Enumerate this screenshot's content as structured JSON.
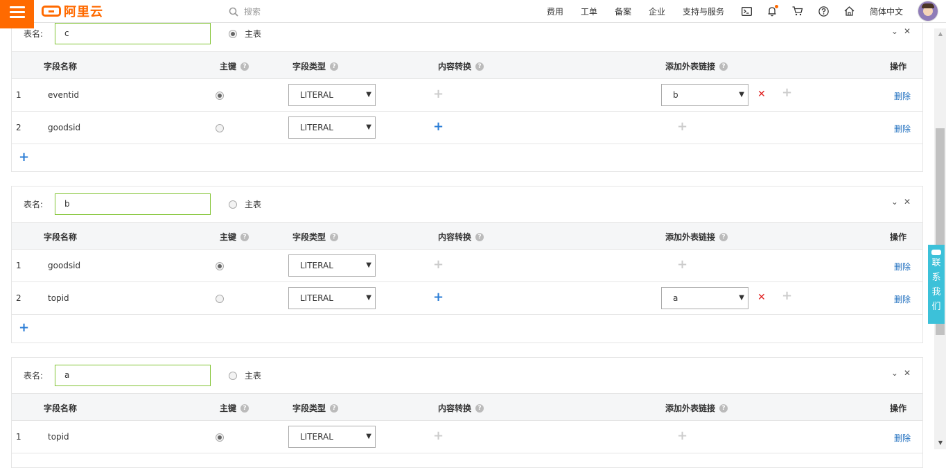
{
  "header": {
    "logo_text": "阿里云",
    "search_placeholder": "搜索",
    "nav": [
      "费用",
      "工单",
      "备案",
      "企业",
      "支持与服务"
    ],
    "language": "简体中文",
    "accent_color": "#ff6a00"
  },
  "labels": {
    "table_name": "表名:",
    "master_table": "主表",
    "delete": "删除"
  },
  "columns": {
    "field_name": "字段名称",
    "primary_key": "主键",
    "field_type": "字段类型",
    "content_convert": "内容转换",
    "foreign_link": "添加外表链接",
    "action": "操作"
  },
  "tables": [
    {
      "name": "c",
      "is_master": true,
      "rows": [
        {
          "index": "1",
          "field": "eventid",
          "pk": true,
          "type": "LITERAL",
          "foreign": "b"
        },
        {
          "index": "2",
          "field": "goodsid",
          "pk": false,
          "type": "LITERAL",
          "foreign": ""
        }
      ]
    },
    {
      "name": "b",
      "is_master": false,
      "rows": [
        {
          "index": "1",
          "field": "goodsid",
          "pk": true,
          "type": "LITERAL",
          "foreign": ""
        },
        {
          "index": "2",
          "field": "topid",
          "pk": false,
          "type": "LITERAL",
          "foreign": "a"
        }
      ]
    },
    {
      "name": "a",
      "is_master": false,
      "rows": [
        {
          "index": "1",
          "field": "topid",
          "pk": true,
          "type": "LITERAL",
          "foreign": ""
        }
      ]
    }
  ],
  "contact": "联系我们"
}
